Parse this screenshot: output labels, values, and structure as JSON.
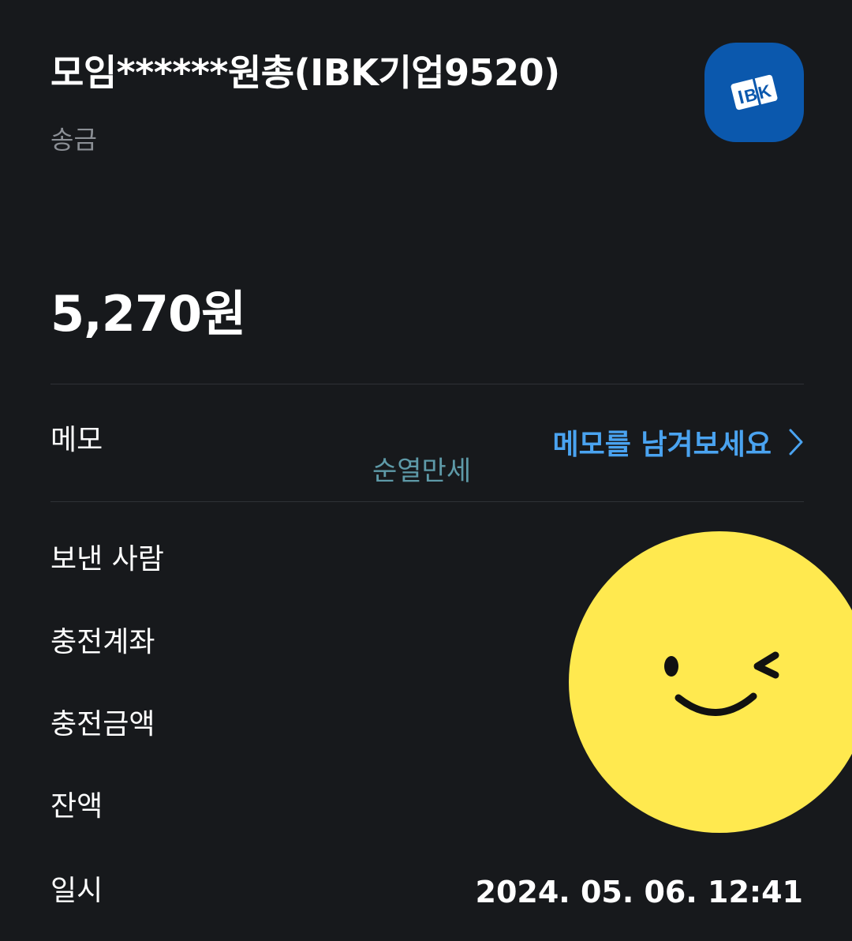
{
  "header": {
    "title": "모임******원총(IBK기업9520)",
    "subtitle": "송금",
    "bank_logo_icon": "ibk-bank-logo-icon"
  },
  "amount": "5,270원",
  "memo": {
    "label": "메모",
    "link_label": "메모를 남겨보세요",
    "content": "순열만세"
  },
  "details": {
    "sender_label": "보낸 사람",
    "charge_account_label": "충전계좌",
    "charge_amount_label": "충전금액",
    "balance_label": "잔액",
    "datetime_label": "일시",
    "datetime_value": "2024. 05. 06. 12:41"
  },
  "colors": {
    "background": "#17191c",
    "accent": "#4aa3f0",
    "memo_text": "#5e9aa8",
    "bank_logo": "#0b58ad",
    "sticker": "#ffe94f"
  }
}
